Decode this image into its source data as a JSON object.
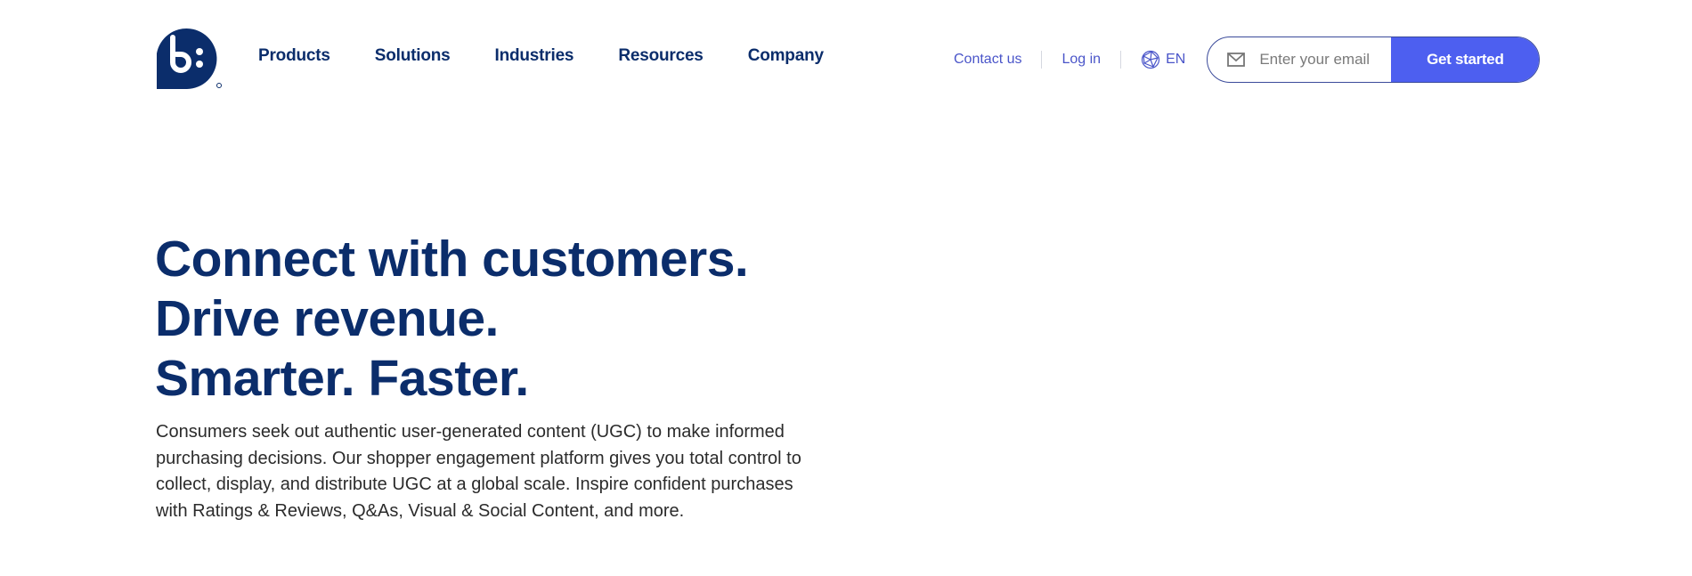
{
  "header": {
    "logo_text": "b:",
    "nav": [
      "Products",
      "Solutions",
      "Industries",
      "Resources",
      "Company"
    ],
    "contact_label": "Contact us",
    "login_label": "Log in",
    "language": "EN",
    "email_placeholder": "Enter your email",
    "cta_label": "Get started",
    "icons": {
      "language": "globe-icon",
      "email": "envelope-icon"
    }
  },
  "hero": {
    "headline": [
      "Connect with customers.",
      "Drive revenue.",
      "Smarter. Faster."
    ],
    "description": "Consumers seek out authentic user-generated content (UGC) to make informed purchasing decisions. Our shopper engagement platform gives you total control to collect, display, and distribute UGC at a global scale. Inspire confident purchases with Ratings & Reviews, Q&As, Visual & Social Content, and more."
  },
  "colors": {
    "brand": "#0b2d6b",
    "accent": "#4d5ff0",
    "link": "#4a55c9"
  }
}
